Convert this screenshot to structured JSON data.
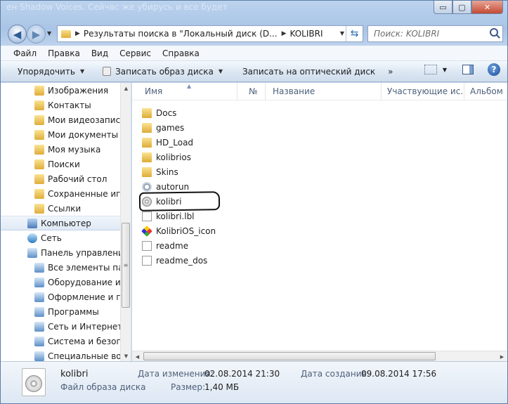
{
  "window": {
    "title": "ен Shadow Voices. Сейчас же убирусь и все будет",
    "controls": {
      "minimize": "▭",
      "maximize": "▢",
      "close": "✕"
    }
  },
  "address": {
    "crumbs": [
      "Результаты поиска в \"Локальный диск (D...",
      "KOLIBRI"
    ],
    "search_placeholder": "Поиск: KOLIBRI"
  },
  "menu": [
    "Файл",
    "Правка",
    "Вид",
    "Сервис",
    "Справка"
  ],
  "toolbar": {
    "organize": "Упорядочить",
    "burn_image": "Записать образ диска",
    "burn_disc": "Записать на оптический диск",
    "more": "»"
  },
  "nav": {
    "items": [
      {
        "label": "Изображения",
        "icon": "folder",
        "indent": 48
      },
      {
        "label": "Контакты",
        "icon": "folder",
        "indent": 48
      },
      {
        "label": "Мои видеозаписи",
        "icon": "folder",
        "indent": 48
      },
      {
        "label": "Мои документы",
        "icon": "folder",
        "indent": 48
      },
      {
        "label": "Моя музыка",
        "icon": "folder",
        "indent": 48
      },
      {
        "label": "Поиски",
        "icon": "folder",
        "indent": 48
      },
      {
        "label": "Рабочий стол",
        "icon": "folder",
        "indent": 48
      },
      {
        "label": "Сохраненные игры",
        "icon": "folder",
        "indent": 48
      },
      {
        "label": "Ссылки",
        "icon": "folder",
        "indent": 48
      },
      {
        "label": "Компьютер",
        "icon": "comp",
        "indent": 38,
        "selected": true
      },
      {
        "label": "Сеть",
        "icon": "net",
        "indent": 38
      },
      {
        "label": "Панель управления",
        "icon": "cp",
        "indent": 38
      },
      {
        "label": "Все элементы пане",
        "icon": "cp",
        "indent": 48
      },
      {
        "label": "Оборудование и з",
        "icon": "cp",
        "indent": 48
      },
      {
        "label": "Оформление и пе",
        "icon": "cp",
        "indent": 48
      },
      {
        "label": "Программы",
        "icon": "cp",
        "indent": 48
      },
      {
        "label": "Сеть и Интернет",
        "icon": "cp",
        "indent": 48
      },
      {
        "label": "Система и безопа",
        "icon": "cp",
        "indent": 48
      },
      {
        "label": "Специальные воз",
        "icon": "cp",
        "indent": 48
      }
    ]
  },
  "columns": [
    "Имя",
    "№",
    "Название",
    "Участвующие ис...",
    "Альбом"
  ],
  "files": [
    {
      "name": "Docs",
      "icon": "folder"
    },
    {
      "name": "games",
      "icon": "folder"
    },
    {
      "name": "HD_Load",
      "icon": "folder"
    },
    {
      "name": "kolibrios",
      "icon": "folder"
    },
    {
      "name": "Skins",
      "icon": "folder"
    },
    {
      "name": "autorun",
      "icon": "gear"
    },
    {
      "name": "kolibri",
      "icon": "disc",
      "selected": true
    },
    {
      "name": "kolibri.lbl",
      "icon": "doc"
    },
    {
      "name": "KolibriOS_icon",
      "icon": "app"
    },
    {
      "name": "readme",
      "icon": "doc"
    },
    {
      "name": "readme_dos",
      "icon": "doc"
    }
  ],
  "details": {
    "name": "kolibri",
    "type": "Файл образа диска",
    "modified_label": "Дата изменения:",
    "modified_value": "02.08.2014 21:30",
    "created_label": "Дата создания:",
    "created_value": "09.08.2014 17:56",
    "size_label": "Размер:",
    "size_value": "1,40 МБ"
  }
}
